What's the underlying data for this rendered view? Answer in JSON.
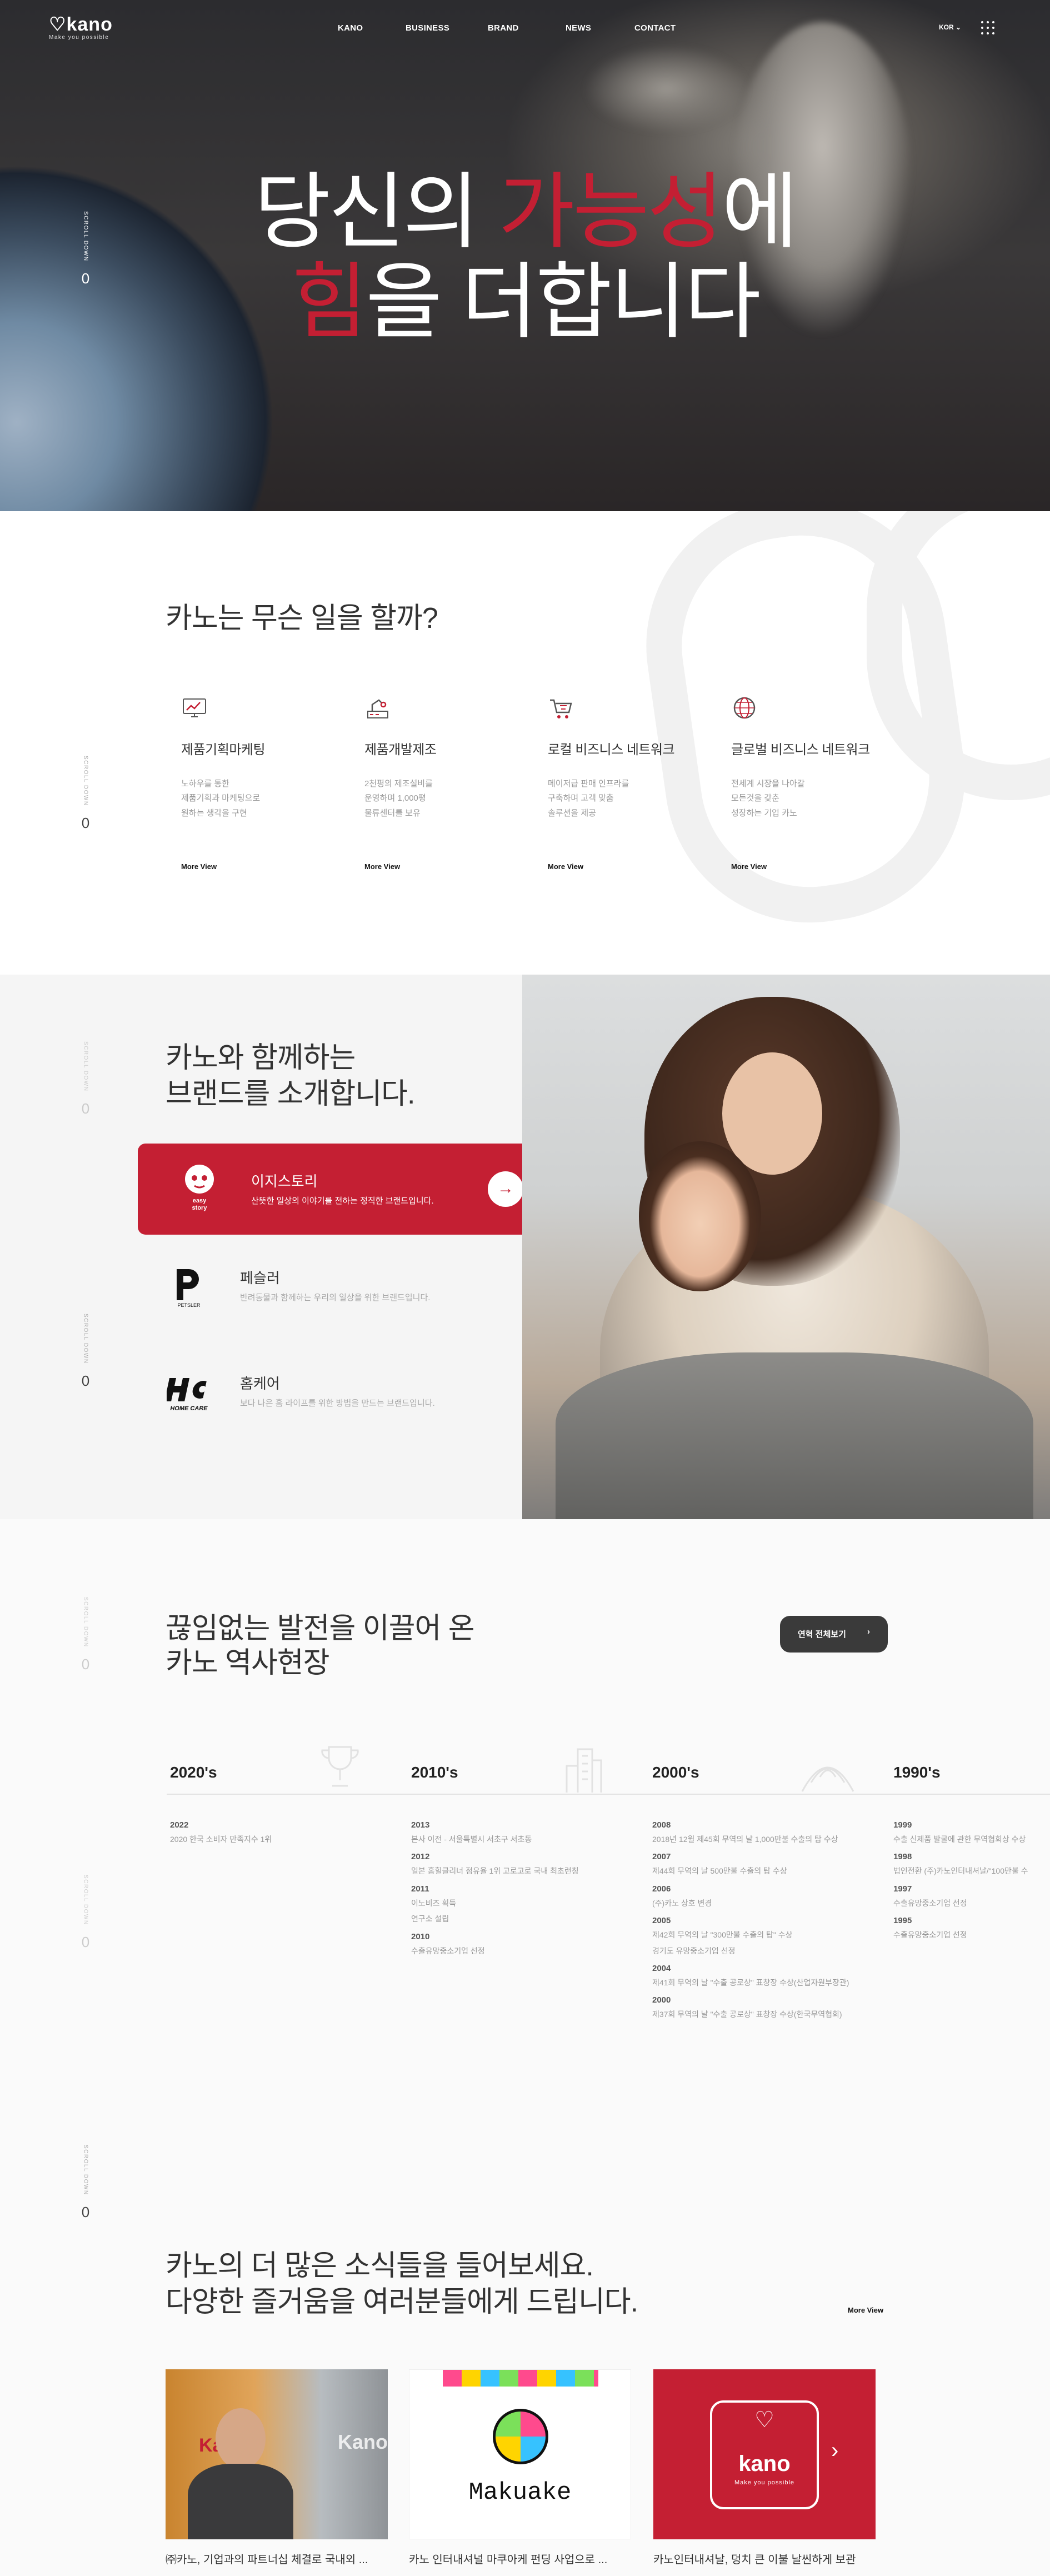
{
  "header": {
    "logo": "kano",
    "logo_tagline": "Make you possible",
    "nav": [
      "KANO",
      "BUSINESS",
      "BRAND",
      "NEWS",
      "CONTACT"
    ],
    "lang": "KOR"
  },
  "scroll": {
    "label": "SCROLL DOWN",
    "count": "0"
  },
  "hero": {
    "line1_a": "당신의 ",
    "line1_red": "가능성",
    "line1_b": "에",
    "line2_red": "힘",
    "line2_b": "을 더합니다"
  },
  "services": {
    "title": "카노는 무슨 일을 할까?",
    "items": [
      {
        "icon": "monitor-chart-icon",
        "title": "제품기획마케팅",
        "lines": [
          "노하우를 통한",
          "제품기획과 마케팅으로",
          "원하는 생각을 구현"
        ],
        "more": "More View"
      },
      {
        "icon": "factory-robot-icon",
        "title": "제품개발제조",
        "lines": [
          "2천평의 제조설비를",
          "운영하며 1,000평",
          "물류센터를 보유"
        ],
        "more": "More View"
      },
      {
        "icon": "shopping-cart-icon",
        "title": "로컬 비즈니스 네트워크",
        "lines": [
          "메이저급 판매 인프라를",
          "구축하며 고객 맞춤",
          "솔루션을 제공"
        ],
        "more": "More View"
      },
      {
        "icon": "globe-icon",
        "title": "글로벌 비즈니스 네트워크",
        "lines": [
          "전세계 시장을 나아갈",
          "모든것을 갖춘",
          "성장하는 기업 카노"
        ],
        "more": "More View"
      }
    ]
  },
  "brands": {
    "title_line1": "카노와 함께하는",
    "title_line2": "브랜드를 소개합니다.",
    "items": [
      {
        "name": "이지스토리",
        "desc": "산뜻한 일상의 이야기를 전하는 정직한 브랜드입니다.",
        "logo_text": "easy story"
      },
      {
        "name": "페슬러",
        "desc": "반려동물과 함께하는 우리의 일상을 위한 브랜드입니다.",
        "logo_text": "PETSLER"
      },
      {
        "name": "홈케어",
        "desc": "보다 나은 홈 라이프를 위한 방법을 만드는 브랜드입니다.",
        "logo_text": "HOME CARE"
      }
    ]
  },
  "history": {
    "title_line1": "끊임없는 발전을 이끌어 온",
    "title_line2": "카노 역사현장",
    "button": "연혁 전체보기",
    "eras": [
      {
        "era": "2020's",
        "entries": [
          {
            "year": "2022",
            "events": [
              "2020 한국 소비자 만족지수 1위"
            ]
          }
        ]
      },
      {
        "era": "2010's",
        "entries": [
          {
            "year": "2013",
            "events": [
              "본사 이전 - 서울특별시 서초구 서초동"
            ]
          },
          {
            "year": "2012",
            "events": [
              "일본 홈힐클리너 점유율 1위 고로고로 국내 최초런칭"
            ]
          },
          {
            "year": "2011",
            "events": [
              "이노비즈 획득",
              "연구소 설립"
            ]
          },
          {
            "year": "2010",
            "events": [
              "수출유망중소기업 선정"
            ]
          }
        ]
      },
      {
        "era": "2000's",
        "entries": [
          {
            "year": "2008",
            "events": [
              "2018년 12월 제45회 무역의 날 1,000만불 수출의 탑 수상"
            ]
          },
          {
            "year": "2007",
            "events": [
              "제44회 무역의 날 500만불 수출의 탑 수상"
            ]
          },
          {
            "year": "2006",
            "events": [
              "(주)카노 상호 변경"
            ]
          },
          {
            "year": "2005",
            "events": [
              "제42회 무역의 날 \"300만불 수출의 탑\" 수상",
              "경기도 유망중소기업 선정"
            ]
          },
          {
            "year": "2004",
            "events": [
              "제41회 무역의 날 \"수출 공로상\" 표창장 수상(산업자원부장관)"
            ]
          },
          {
            "year": "2000",
            "events": [
              "제37회 무역의 날 \"수출 공로상\" 표창장 수상(한국무역협회)"
            ]
          }
        ]
      },
      {
        "era": "1990's",
        "entries": [
          {
            "year": "1999",
            "events": [
              "수출 신제품 발굴에 관한 무역협회상 수상"
            ]
          },
          {
            "year": "1998",
            "events": [
              "법인전환 (주)카노인터내셔날/\"100만불 수"
            ]
          },
          {
            "year": "1997",
            "events": [
              "수출유망중소기업 선정"
            ]
          },
          {
            "year": "1995",
            "events": [
              "수출유망중소기업 선정"
            ]
          }
        ]
      }
    ]
  },
  "news": {
    "title_line1": "카노의 더 많은 소식들을 들어보세요.",
    "title_line2": "다양한 즐거움을 여러분들에게 드립니다.",
    "more": "More View",
    "items": [
      {
        "title": "㈜카노, 기업과의 파트너십 체결로 국내외 ...",
        "image_text": "Kano"
      },
      {
        "title": "카노 인터내셔널 마쿠아케 펀딩 사업으로 ...",
        "image_text": "Makuake"
      },
      {
        "title": "카노인터내셔날, 덩치 큰 이불 날씬하게 보관",
        "image_text": "kano",
        "image_sub": "Make you possible"
      }
    ]
  },
  "colors": {
    "brand_red": "#c41f33",
    "dark_button": "#3a3a3a"
  }
}
